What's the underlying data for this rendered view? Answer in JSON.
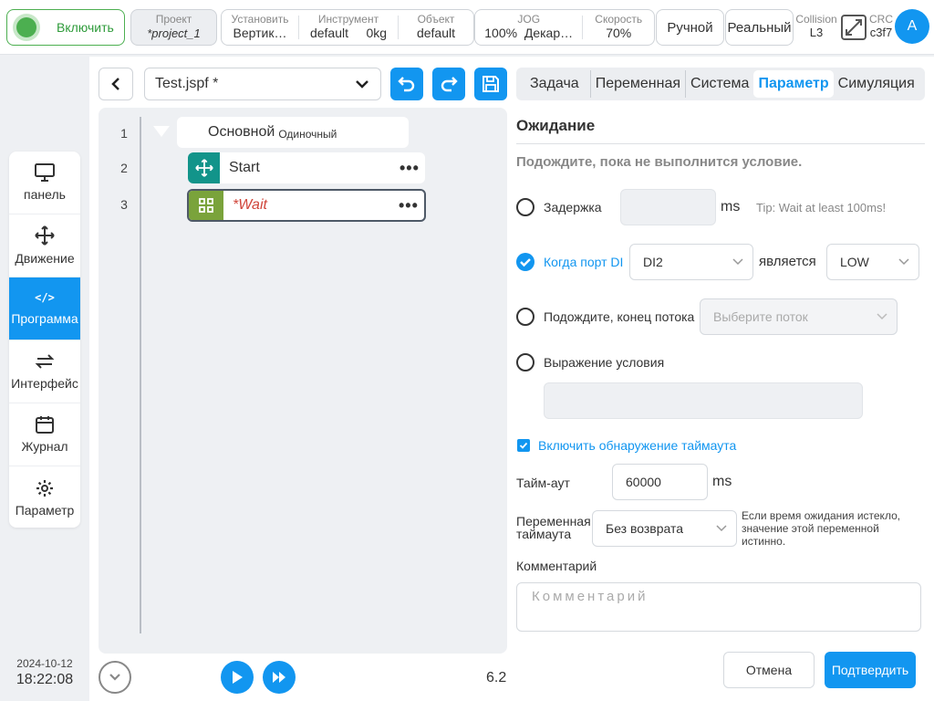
{
  "topbar": {
    "power_label": "Включить",
    "project": {
      "label": "Проект",
      "value": "*project_1"
    },
    "install": {
      "label": "Установить",
      "value": "Вертик…"
    },
    "tool": {
      "label": "Инструмент",
      "value": "default",
      "weight": "0kg"
    },
    "object": {
      "label": "Объект",
      "value": "default"
    },
    "jog": {
      "label": "JOG",
      "value": "100%",
      "frame": "Декар…"
    },
    "speed": {
      "label": "Скорость",
      "value": "70%"
    },
    "mode_manual": "Ручной",
    "mode_real": "Реальный",
    "collision": {
      "label": "Collision",
      "value": "L3"
    },
    "crc": {
      "label": "CRC",
      "value": "c3f7"
    },
    "avatar": "A"
  },
  "nav": {
    "items": [
      {
        "label": "панель",
        "icon": "monitor-icon"
      },
      {
        "label": "Движение",
        "icon": "move-icon"
      },
      {
        "label": "Программа",
        "icon": "code-icon",
        "glyph": "</>"
      },
      {
        "label": "Интерфейс",
        "icon": "swap-icon"
      },
      {
        "label": "Журнал",
        "icon": "calendar-icon"
      },
      {
        "label": "Параметр",
        "icon": "gear-icon"
      }
    ],
    "active": "Программа"
  },
  "datetime": {
    "date": "2024-10-12",
    "time": "18:22:08"
  },
  "editor": {
    "file": "Test.jspf *",
    "lines": [
      "1",
      "2",
      "3"
    ],
    "root": {
      "title": "Основной",
      "subtitle": "Одиночный"
    },
    "blocks": [
      {
        "name": "Start",
        "icon": "move-icon",
        "color": "#12948a"
      },
      {
        "name": "*Wait",
        "icon": "grid-icon",
        "color": "#7aa33b"
      }
    ],
    "more": "•••",
    "version": "6.2"
  },
  "tabs": [
    "Задача",
    "Переменная",
    "Система",
    "Параметр",
    "Симуляция"
  ],
  "tab_active": "Параметр",
  "wait": {
    "title": "Ожидание",
    "description": "Подождите, пока не выполнится условие.",
    "delay": {
      "label": "Задержка",
      "value": "",
      "unit": "ms",
      "tip": "Tip: Wait at least 100ms!"
    },
    "di": {
      "label": "Когда порт DI",
      "port": "DI2",
      "is_label": "является",
      "level": "LOW",
      "checked": true
    },
    "thread": {
      "label": "Подождите, конец потока",
      "placeholder": "Выберите поток"
    },
    "expr": {
      "label": "Выражение условия",
      "value": ""
    },
    "timeout_enable": {
      "label": "Включить обнаружение таймаута",
      "checked": true
    },
    "timeout": {
      "label": "Тайм-аут",
      "value": "60000",
      "unit": "ms"
    },
    "timeout_var": {
      "label_line1": "Переменная",
      "label_line2": "таймаута",
      "value": "Без возврата",
      "note": "Если время ожидания истекло, значение этой переменной истинно."
    },
    "comment": {
      "label": "Комментарий",
      "placeholder": "Комментарий"
    }
  },
  "buttons": {
    "cancel": "Отмена",
    "confirm": "Подтвердить"
  },
  "colors": {
    "accent": "#1296f0",
    "power": "#4caf50",
    "wait_text": "#d0453a"
  }
}
